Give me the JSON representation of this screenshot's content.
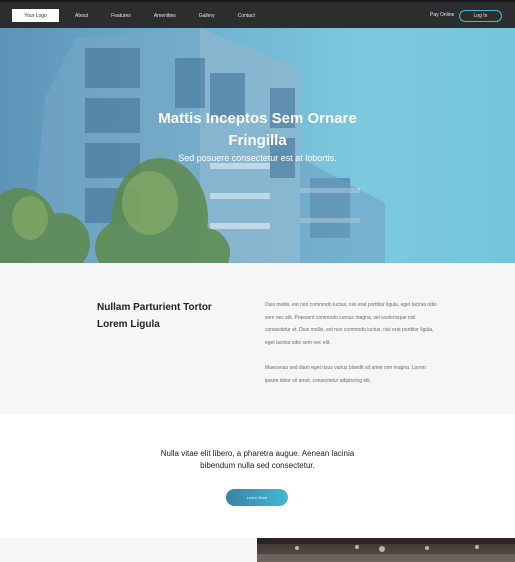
{
  "nav": {
    "logo_label": "Your Logo",
    "links": [
      "About",
      "Features",
      "Amenities",
      "Gallery",
      "Contact"
    ],
    "pay_online": "Pay Online",
    "login_label": "Log In"
  },
  "hero": {
    "title_line1": "Mattis Inceptos Sem Ornare",
    "title_line2": "Fringilla",
    "subtitle": "Sed posuere consectetur est at lobortis."
  },
  "intro": {
    "heading_line1": "Nullam Parturient Tortor",
    "heading_line2": "Lorem Ligula",
    "paragraph1": "Duis mollis, est non commodo luctus, nisi erat porttitor ligula, eget lacinia odio sem nec elit. Praesent commodo cursus magna, vel scelerisque nisl consectetur et. Duis mollis, est non commodo luctus, nisi erat porttitor ligula, eget lacinia odio sem nec elit.",
    "paragraph2": "Maecenas sed diam eget risus varius blandit sit amet non magna. Lorem ipsum dolor sit amet, consectetur adipiscing elit."
  },
  "cta": {
    "text": "Nulla vitae elit libero, a pharetra augue. Aenean lacinia bibendum nulla sed consectetur.",
    "button_label": "Learn More"
  },
  "colors": {
    "accent": "#42b8d3",
    "nav_bg": "#2b2d2f"
  }
}
